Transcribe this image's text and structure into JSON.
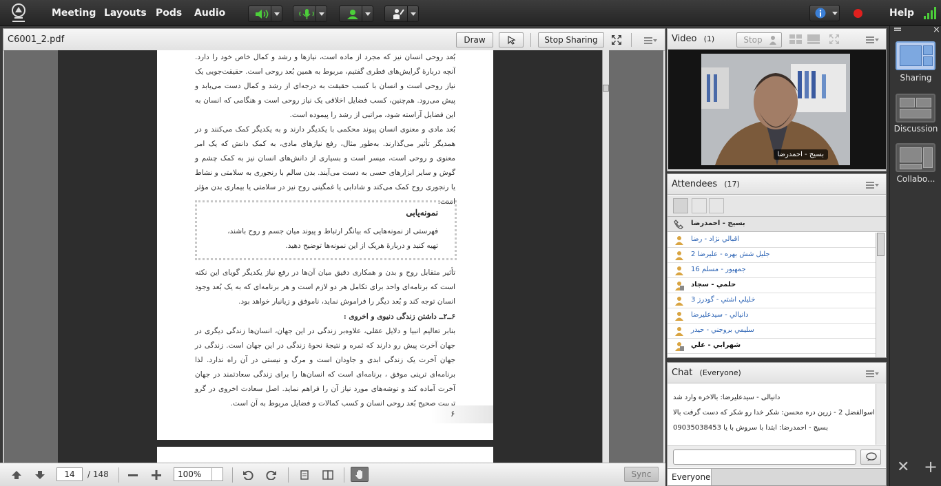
{
  "topbar": {
    "menus": [
      "Meeting",
      "Layouts",
      "Pods",
      "Audio"
    ],
    "help": "Help"
  },
  "share_pod": {
    "title": "C6001_2.pdf",
    "draw_label": "Draw",
    "stop_sharing_label": "Stop Sharing"
  },
  "document": {
    "para1": "بُعد روحی انسان نیز که مجرد از ماده است، نیازها و رشد و کمال خاص خود را دارد. آنچه دربارهٔ گرایش‌های فطری گفتیم، مربوط به همین بُعد روحی است. حقیقت‌جویی یک نیاز روحی است و انسان با کسب حقیقت به درجه‌ای از رشد و کمال دست می‌یابد و پیش می‌رود. هم‌چنین، کسب فضایل اخلاقی یک نیاز روحی است و هنگامی که انسان به این فضایل آراسته شود، مراتبی از رشد را پیموده است.",
    "para2": "بُعد مادی و معنوی انسان پیوند محکمی با یکدیگر دارند و به یکدیگر کمک می‌کنند و در همدیگر تأثیر می‌گذارند. به‌طور مثال، رفع نیازهای مادی، به کمک دانش که یک امر معنوی و روحی است، میسر است و بسیاری از دانش‌های انسان نیز به کمک چشم و گوش و سایر ابزارهای حسی به دست می‌آیند. بدن سالم با رنجوری به سلامتی و نشاط یا رنجوری روح کمک می‌کند و شادابی یا غمگینی روح نیز در سلامتی یا بیماری بدن مؤثر است.",
    "box_title": "نمونه‌یابی",
    "box_text": "فهرستی از نمونه‌هایی که بیانگر ارتباط و پیوند میان جسم و روح باشند، تهیه کنید و دربارهٔ هریک از این نمونه‌ها توضیح دهید.",
    "para3": "تأثیر متقابل روح و بدن و همکاری دقیق میان آن‌ها در رفع نیاز یکدیگر گویای این نکته است که برنامه‌ای واحد برای تکامل هر دو لازم است و هر برنامه‌ای که به یک بُعد وجود انسان توجه کند و بُعد دیگر را فراموش نماید، ناموفق و زیانبار خواهد بود.",
    "heading4": "۶ــ۲ــ داشتن زندگی دنیوی و اخروی :",
    "para4": "بنابر تعالیم انبیا و دلایل عقلی، علاوه‌بر زندگی در این جهان، انسان‌ها زندگی دیگری در جهان آخرت پیش رو دارند که ثمره و نتیجهٔ نحوهٔ زندگی در این جهان است. زندگی در جهان آخرت یک زندگی ابدی و جاودان است و مرگ و نیستی در آن راه ندارد. لذا برنامه‌ای ترینی موفق ، برنامه‌ای است که انسان‌ها را برای زندگی سعادتمند در جهان آخرت آماده کند و توشه‌های مورد نیاز آن را فراهم نماید. اصل سعادت اخروی در گرو تربیت صحیح بُعد روحی انسان و کسب کمالات و فضایل مربوط به آن است.",
    "page_number": "۶"
  },
  "toolbar_bottom": {
    "page_current": "14",
    "page_total": "/ 148",
    "zoom": "100%",
    "sync_label": "Sync"
  },
  "video_pod": {
    "title": "Video",
    "count": "(1)",
    "stop_label": "Stop",
    "speaker_name": "بسیج - احمدرضا"
  },
  "attendees_pod": {
    "title": "Attendees",
    "count": "(17)",
    "presenter": "بسیج - احمدرضا",
    "list": [
      {
        "name": "اقبالي نژاد - رضا",
        "bold": false
      },
      {
        "name": "جليل شش بهره - عليرضا 2",
        "bold": false
      },
      {
        "name": "جمهیور - مسلم 16",
        "bold": false
      },
      {
        "name": "حلمي - سجاد",
        "bold": true
      },
      {
        "name": "خليلي اشتي - گودرز 3",
        "bold": false
      },
      {
        "name": "دانيالي - سيدعليرضا",
        "bold": false
      },
      {
        "name": "سليمي بروجني - حيدر",
        "bold": false
      },
      {
        "name": "شهرابي - علي",
        "bold": true
      }
    ]
  },
  "chat_pod": {
    "title": "Chat",
    "scope": "(Everyone)",
    "messages": [
      "دانیالی - سیدعلیرضا: بالاخره وارد شد",
      "اسوالفضل 2 - زرین دره محسن: شکر خدا رو شکر که دست گرفت بالا",
      "بسیج - احمدرضا: ابتدا با سروش با یا 09035038453"
    ],
    "tab_everyone": "Everyone"
  },
  "layouts_bar": {
    "items": [
      "Sharing",
      "Discussion",
      "Collabo..."
    ]
  },
  "colors": {
    "topbar": "#2d2d2d",
    "accent_blue": "#2a62b4",
    "record_red": "#e0201e",
    "mic_green": "#4ccf3a"
  }
}
